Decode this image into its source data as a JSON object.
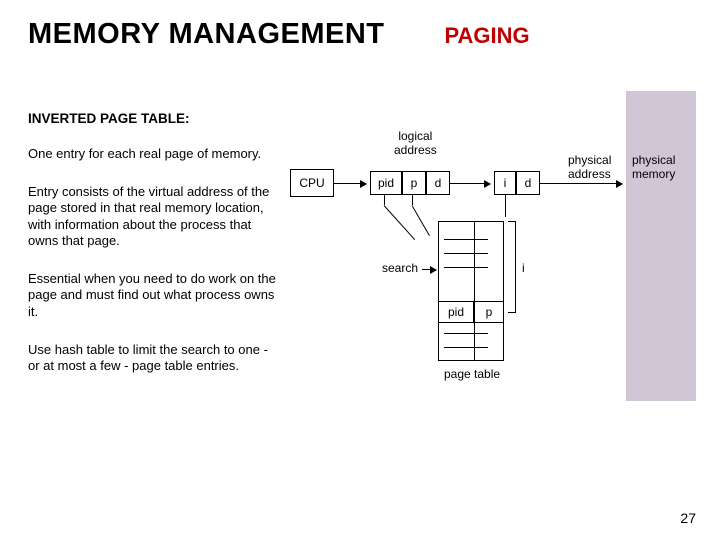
{
  "header": {
    "title_main": "MEMORY MANAGEMENT",
    "title_sub": "PAGING"
  },
  "content": {
    "subtitle": "INVERTED PAGE TABLE:",
    "paragraphs": [
      "One entry for each real page of memory.",
      "Entry consists of the virtual address of the page stored in that real memory location, with information about the process that owns that page.",
      "Essential when you need to do work on the page and must find out what process owns it.",
      "Use hash table to limit the search to one - or at most a few - page table entries."
    ]
  },
  "diagram": {
    "cpu": "CPU",
    "logical_address": "logical\naddress",
    "physical_address": "physical\naddress",
    "physical_memory": "physical\nmemory",
    "pid": "pid",
    "p": "p",
    "d": "d",
    "i": "i",
    "search": "search",
    "page_table": "page table"
  },
  "page_number": "27"
}
